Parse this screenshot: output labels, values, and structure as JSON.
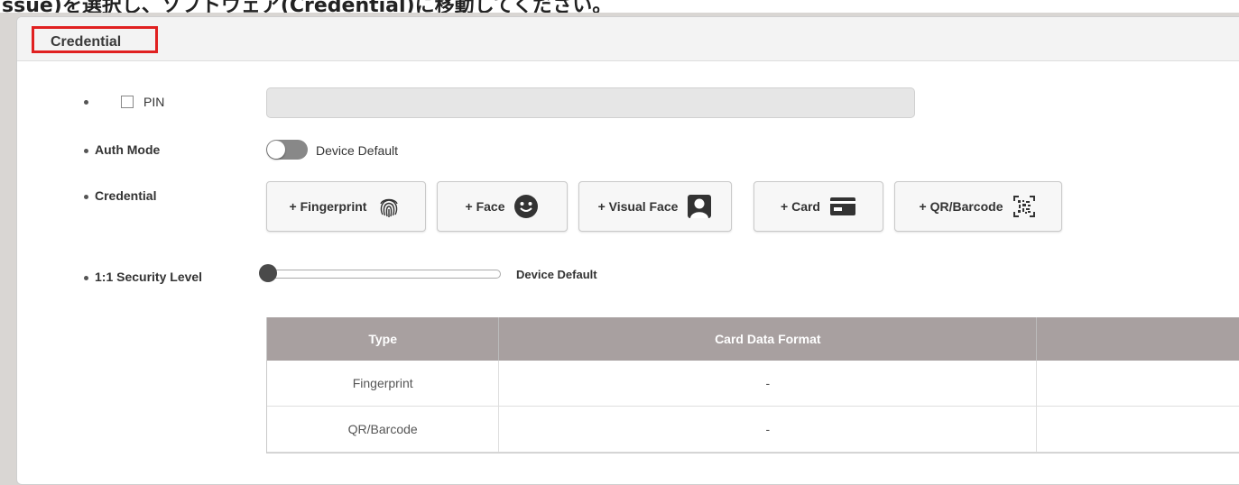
{
  "header_fragment": "ssue)を選択し、ソフトウェア(Credential)に移動してください。",
  "panel": {
    "title": "Credential"
  },
  "pin": {
    "label": "PIN",
    "value": ""
  },
  "auth_mode": {
    "label": "Auth Mode",
    "toggle_text": "Device Default",
    "enabled": false
  },
  "credential": {
    "label": "Credential",
    "buttons": [
      {
        "label": "+ Fingerprint",
        "icon": "fingerprint-icon"
      },
      {
        "label": "+ Face",
        "icon": "face-icon"
      },
      {
        "label": "+ Visual Face",
        "icon": "visual-face-icon"
      },
      {
        "label": "+ Card",
        "icon": "card-icon"
      },
      {
        "label": "+ QR/Barcode",
        "icon": "qr-barcode-icon"
      }
    ]
  },
  "security_level": {
    "label": "1:1 Security Level",
    "value_text": "Device Default",
    "level": 0
  },
  "table": {
    "headers": [
      "Type",
      "Card Data Format",
      ""
    ],
    "rows": [
      [
        "Fingerprint",
        "-",
        ""
      ],
      [
        "QR/Barcode",
        "-",
        ""
      ]
    ]
  },
  "colors": {
    "highlight_box": "#e02020",
    "table_header": "#a8a0a0",
    "toggle_off": "#888888",
    "slider_thumb": "#4a4a4a"
  }
}
